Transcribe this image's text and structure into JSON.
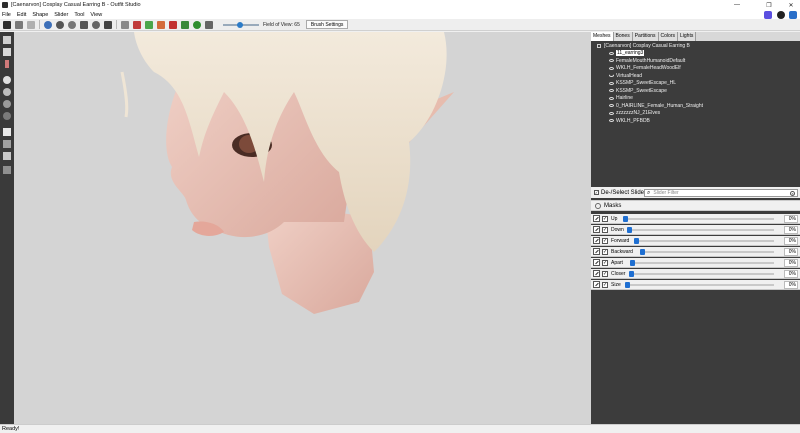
{
  "window": {
    "title": "[Caenarvon] Cosplay Casual Earring B - Outfit Studio",
    "minimize": "—",
    "maximize": "❐",
    "close": "✕"
  },
  "menu": [
    "File",
    "Edit",
    "Shape",
    "Slider",
    "Tool",
    "View"
  ],
  "toolbar": {
    "fov_label": "Field of View: 65",
    "brush_settings": "Brush Settings"
  },
  "tabs": [
    "Meshes",
    "Bones",
    "Partitions",
    "Colors",
    "Lights"
  ],
  "mesh_root": "[Caenarvon] Cosplay Casual Earring B",
  "meshes": [
    {
      "name": "11_earring3",
      "selected": true
    },
    {
      "name": "FemaleMouthHumanoidDefault",
      "selected": false
    },
    {
      "name": "WKLH_FemaleHeadWoodElf",
      "selected": false
    },
    {
      "name": "VirtualHead",
      "selected": false
    },
    {
      "name": "KSSMP_SweetEscape_HL",
      "selected": false
    },
    {
      "name": "KSSMP_SweetEscape",
      "selected": false
    },
    {
      "name": "Hairline",
      "selected": false
    },
    {
      "name": "0_HAIRLINE_Female_Human_Straight",
      "selected": false
    },
    {
      "name": "zzzzzzzNJ_21Elves",
      "selected": false
    },
    {
      "name": "WKLH_PFBDB",
      "selected": false
    }
  ],
  "slider_panel": {
    "deselect_label": "De-/Select Sliders",
    "filter_placeholder": "Slider Filter",
    "masks_label": "Masks"
  },
  "sliders": [
    {
      "name": "Up",
      "value": "0%"
    },
    {
      "name": "Down",
      "value": "0%"
    },
    {
      "name": "Forward",
      "value": "0%"
    },
    {
      "name": "Backward",
      "value": "0%"
    },
    {
      "name": "Apart",
      "value": "0%"
    },
    {
      "name": "Closer",
      "value": "0%"
    },
    {
      "name": "Size",
      "value": "0%"
    }
  ],
  "status": "Ready!",
  "colors": {
    "viewport_bg": "#d4d4d4",
    "panel_dark": "#3c3c3c",
    "accent": "#1f6fd1"
  }
}
